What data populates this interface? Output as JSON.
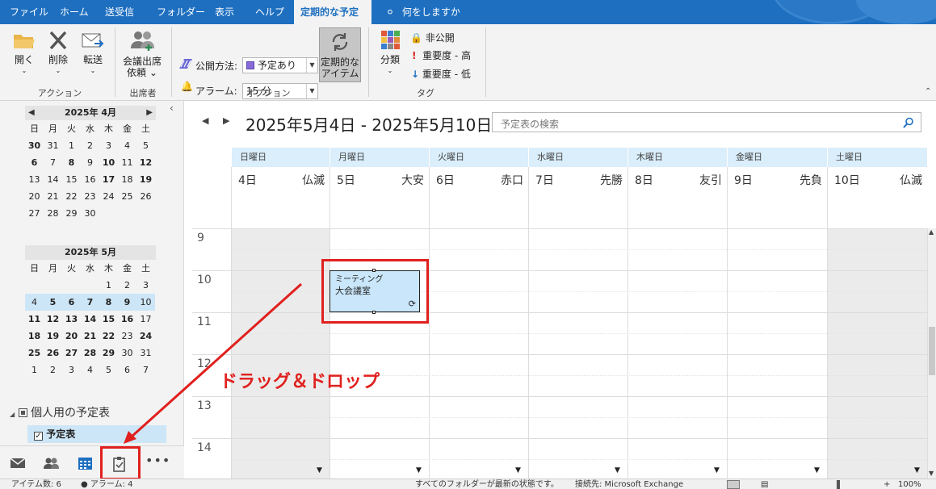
{
  "tabs": [
    "ファイル",
    "ホーム",
    "送受信",
    "フォルダー",
    "表示",
    "ヘルプ",
    "定期的な予定"
  ],
  "tell_me": "何をしますか",
  "ribbon": {
    "open": "開く",
    "delete": "削除",
    "forward": "転送",
    "group_action": "アクション",
    "meeting_request_1": "会議出席",
    "meeting_request_2": "依頼",
    "group_attendees": "出席者",
    "show_as_label": "公開方法:",
    "show_as_value": "予定あり",
    "reminder_label": "アラーム:",
    "reminder_value": "15 分",
    "recurrence_1": "定期的な",
    "recurrence_2": "アイテム",
    "group_options": "オプション",
    "categorize": "分類",
    "private": "非公開",
    "importance_high": "重要度 - 高",
    "importance_low": "重要度 - 低",
    "group_tags": "タグ",
    "accent": "#1e6fc0"
  },
  "minical": {
    "april_title": "2025年 4月",
    "may_title": "2025年 5月",
    "weekdays": [
      "日",
      "月",
      "火",
      "水",
      "木",
      "金",
      "土"
    ],
    "april_days": [
      "30",
      "31",
      "1",
      "2",
      "3",
      "4",
      "5",
      "6",
      "7",
      "8",
      "9",
      "10",
      "11",
      "12",
      "13",
      "14",
      "15",
      "16",
      "17",
      "18",
      "19",
      "20",
      "21",
      "22",
      "23",
      "24",
      "25",
      "26",
      "27",
      "28",
      "29",
      "30"
    ],
    "may_days": [
      "",
      "",
      "",
      "",
      "1",
      "2",
      "3",
      "4",
      "5",
      "6",
      "7",
      "8",
      "9",
      "10",
      "11",
      "12",
      "13",
      "14",
      "15",
      "16",
      "17",
      "18",
      "19",
      "20",
      "21",
      "22",
      "23",
      "24",
      "25",
      "26",
      "27",
      "28",
      "29",
      "30",
      "31",
      "1",
      "2",
      "3",
      "4",
      "5",
      "6",
      "7"
    ],
    "today": "12"
  },
  "folders": {
    "group": "個人用の予定表",
    "calendar": "予定表"
  },
  "week": {
    "title": "2025年5月4日 - 2025年5月10日",
    "search_placeholder": "予定表の検索",
    "days": [
      {
        "name": "日曜日",
        "date": "4日",
        "rokuyo": "仏滅"
      },
      {
        "name": "月曜日",
        "date": "5日",
        "rokuyo": "大安"
      },
      {
        "name": "火曜日",
        "date": "6日",
        "rokuyo": "赤口"
      },
      {
        "name": "水曜日",
        "date": "7日",
        "rokuyo": "先勝"
      },
      {
        "name": "木曜日",
        "date": "8日",
        "rokuyo": "友引"
      },
      {
        "name": "金曜日",
        "date": "9日",
        "rokuyo": "先負"
      },
      {
        "name": "土曜日",
        "date": "10日",
        "rokuyo": "仏滅"
      }
    ],
    "hours": [
      "9",
      "10",
      "11",
      "12",
      "13",
      "14"
    ]
  },
  "appointment": {
    "title": "ミーティング",
    "location": "大会議室"
  },
  "annotation": {
    "text": "ドラッグ＆ドロップ",
    "color": "#e0201e"
  },
  "status": {
    "items": "アイテム数: 6",
    "reminders": "アラーム: 4",
    "sync": "すべてのフォルダーが最新の状態です。",
    "connection": "接続先: Microsoft Exchange",
    "zoom": "100%"
  }
}
